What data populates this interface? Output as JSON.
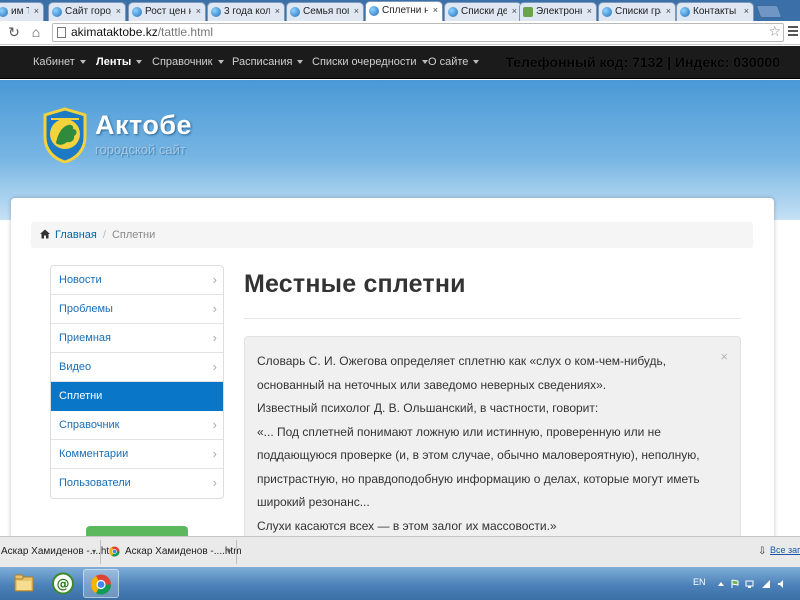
{
  "browser": {
    "tabs": [
      {
        "label": "им Турц",
        "active": false
      },
      {
        "label": "Сайт город",
        "active": false
      },
      {
        "label": "Рост цен на",
        "active": false
      },
      {
        "label": "3 года коло",
        "active": false
      },
      {
        "label": "Семья погиб",
        "active": false
      },
      {
        "label": "Сплетни на",
        "active": true
      },
      {
        "label": "Списки дет",
        "active": false
      },
      {
        "label": "Электронн",
        "active": false
      },
      {
        "label": "Списки гра",
        "active": false
      },
      {
        "label": "Контакты с",
        "active": false
      }
    ],
    "tab_close_glyph": "×",
    "url_host": "akimataktobe.kz",
    "url_path": "/tattle.html"
  },
  "site_nav": {
    "items": [
      {
        "label": "Кабинет",
        "active": false,
        "dropdown": true
      },
      {
        "label": "Ленты",
        "active": true,
        "dropdown": true
      },
      {
        "label": "Справочник",
        "active": false,
        "dropdown": true
      },
      {
        "label": "Расписания",
        "active": false,
        "dropdown": true
      },
      {
        "label": "Списки очередности",
        "active": false,
        "dropdown": true
      },
      {
        "label": "О сайте",
        "active": false,
        "dropdown": true
      }
    ],
    "contact_info": "Телефонный код: 7132 | Индекс: 030000"
  },
  "header": {
    "site_name": "Актобе",
    "tagline": "городской сайт"
  },
  "breadcrumb": {
    "home": "Главная",
    "separator": "/",
    "current": "Сплетни"
  },
  "side_menu": {
    "items": [
      {
        "label": "Новости",
        "active": false
      },
      {
        "label": "Проблемы",
        "active": false
      },
      {
        "label": "Приемная",
        "active": false
      },
      {
        "label": "Видео",
        "active": false
      },
      {
        "label": "Сплетни",
        "active": true
      },
      {
        "label": "Справочник",
        "active": false
      },
      {
        "label": "Комментарии",
        "active": false
      },
      {
        "label": "Пользователи",
        "active": false
      }
    ],
    "chevron": "›"
  },
  "content": {
    "title": "Местные сплетни",
    "close_glyph": "×",
    "lines": [
      "Словарь С. И. Ожегова определяет сплетню как «слух о ком-чем-нибудь,",
      "основанный на неточных или заведомо неверных сведениях».",
      "Известный психолог Д. В. Ольшанский, в частности, говорит:",
      "«... Под сплетней понимают ложную или истинную, проверенную или не",
      "поддающуюся проверке (и, в этом случае, обычно маловероятную), неполную,",
      "пристрастную, но правдоподобную информацию о делах, которые могут иметь",
      "широкий резонанс...",
      "Слухи касаются всех — в этом залог их массовости.»"
    ]
  },
  "downloads": {
    "items": [
      "Аскар Хамиденов -....htm",
      "Аскар Хамиденов -....htm"
    ],
    "show_all": "Все загр"
  },
  "taskbar": {
    "language": "EN"
  },
  "colors": {
    "accent": "#0a76c8",
    "nav_bg": "#1b1b1b",
    "header_top": "#4a99d6",
    "link": "#1a6eb5"
  }
}
